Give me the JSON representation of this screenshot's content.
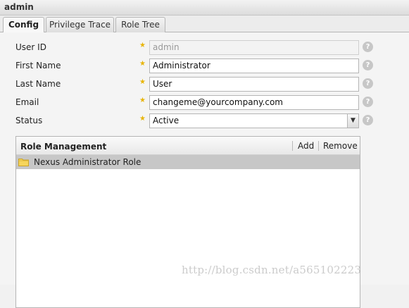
{
  "window": {
    "title": "admin"
  },
  "tabs": [
    {
      "label": "Config",
      "active": true
    },
    {
      "label": "Privilege Trace",
      "active": false
    },
    {
      "label": "Role Tree",
      "active": false
    }
  ],
  "form": {
    "user_id": {
      "label": "User ID",
      "value": "admin",
      "disabled": true
    },
    "first_name": {
      "label": "First Name",
      "value": "Administrator"
    },
    "last_name": {
      "label": "Last Name",
      "value": "User"
    },
    "email": {
      "label": "Email",
      "value": "changeme@yourcompany.com"
    },
    "status": {
      "label": "Status",
      "value": "Active"
    },
    "required_mark": "★",
    "help_mark": "?"
  },
  "role_management": {
    "title": "Role Management",
    "add_label": "Add",
    "remove_label": "Remove",
    "roles": [
      {
        "label": "Nexus Administrator Role"
      }
    ]
  },
  "watermark": "http://blog.csdn.net/a565102223",
  "colors": {
    "required_star": "#e8b400",
    "selected_row": "#c7c7c7",
    "help_icon": "#c7c7c7"
  }
}
